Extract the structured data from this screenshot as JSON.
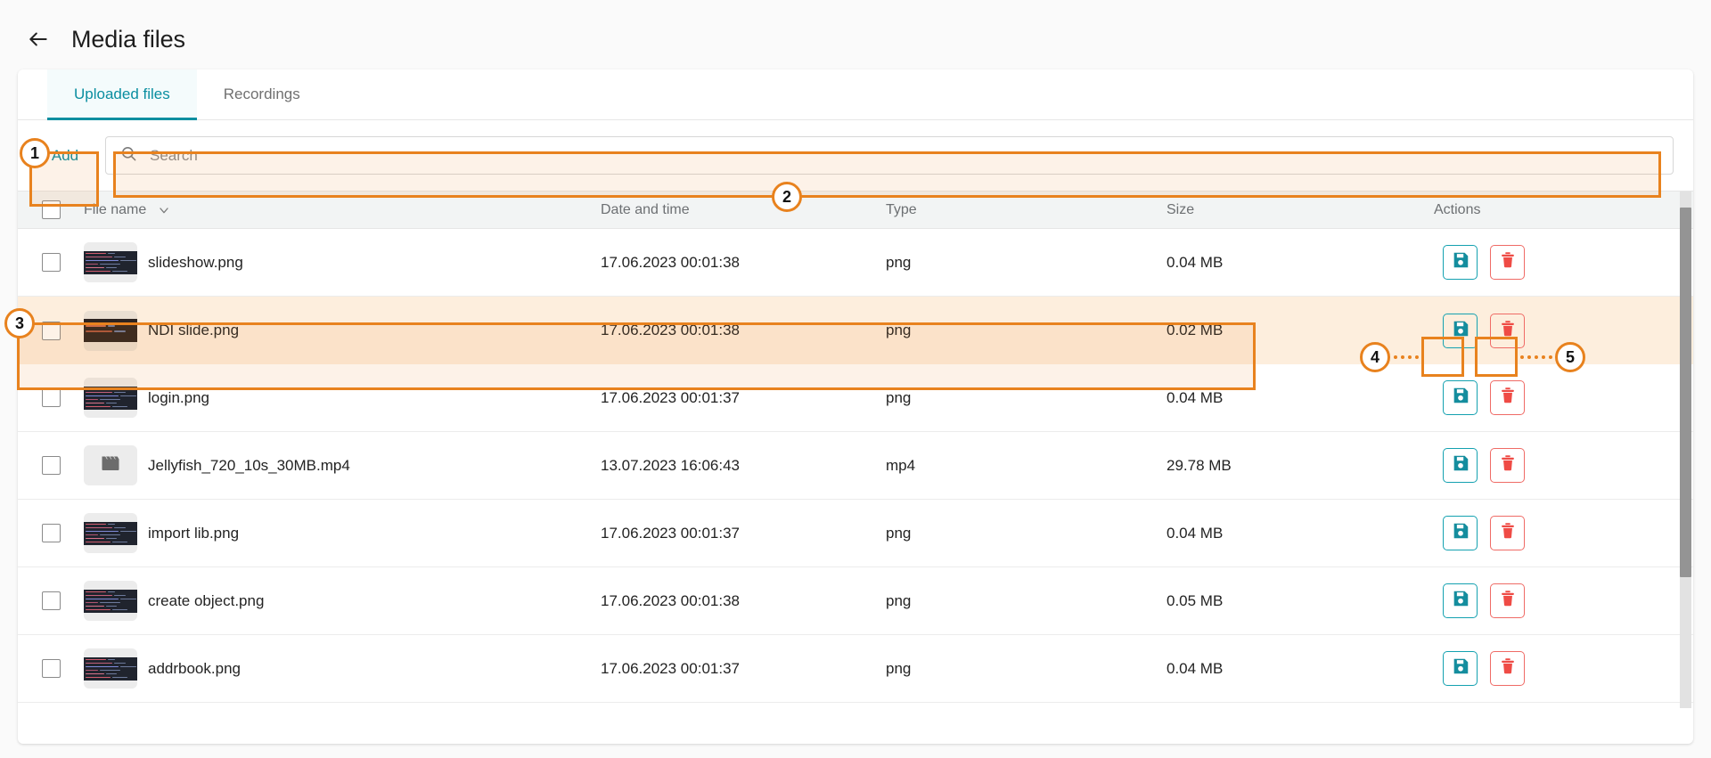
{
  "header": {
    "back_icon": "arrow-left-icon",
    "title": "Media files"
  },
  "tabs": [
    {
      "label": "Uploaded files",
      "active": true
    },
    {
      "label": "Recordings",
      "active": false
    }
  ],
  "toolbar": {
    "add_label": "Add",
    "search_placeholder": "Search",
    "search_value": "",
    "search_icon": "search-icon"
  },
  "table": {
    "columns": [
      {
        "key": "name",
        "label": "File name"
      },
      {
        "key": "date",
        "label": "Date and time"
      },
      {
        "key": "type",
        "label": "Type"
      },
      {
        "key": "size",
        "label": "Size"
      },
      {
        "key": "actions",
        "label": "Actions"
      }
    ],
    "sort_icon": "chevron-down-icon",
    "row_actions": {
      "save_icon": "save-floppy-icon",
      "delete_icon": "trash-icon"
    },
    "rows": [
      {
        "name": "slideshow.png",
        "date": "17.06.2023 00:01:38",
        "type": "png",
        "size": "0.04 MB",
        "thumb": "code",
        "highlight": false
      },
      {
        "name": "NDI slide.png",
        "date": "17.06.2023 00:01:38",
        "type": "png",
        "size": "0.02 MB",
        "thumb": "code-warm",
        "highlight": true
      },
      {
        "name": "login.png",
        "date": "17.06.2023 00:01:37",
        "type": "png",
        "size": "0.04 MB",
        "thumb": "code",
        "highlight": false
      },
      {
        "name": "Jellyfish_720_10s_30MB.mp4",
        "date": "13.07.2023 16:06:43",
        "type": "mp4",
        "size": "29.78 MB",
        "thumb": "video",
        "highlight": false
      },
      {
        "name": "import lib.png",
        "date": "17.06.2023 00:01:37",
        "type": "png",
        "size": "0.04 MB",
        "thumb": "code",
        "highlight": false
      },
      {
        "name": "create object.png",
        "date": "17.06.2023 00:01:38",
        "type": "png",
        "size": "0.05 MB",
        "thumb": "code",
        "highlight": false
      },
      {
        "name": "addrbook.png",
        "date": "17.06.2023 00:01:37",
        "type": "png",
        "size": "0.04 MB",
        "thumb": "code",
        "highlight": false
      }
    ]
  },
  "annotations": [
    {
      "number": "1",
      "target": "add-button"
    },
    {
      "number": "2",
      "target": "search-input"
    },
    {
      "number": "3",
      "target": "file-row-highlighted"
    },
    {
      "number": "4",
      "target": "row-save-button"
    },
    {
      "number": "5",
      "target": "row-delete-button"
    }
  ],
  "colors": {
    "accent_teal": "#0a8ea0",
    "annotation_orange": "#e8821e",
    "highlight_bg": "#fdeedd",
    "delete_red": "#ef4b45",
    "save_teal": "#14a1b0"
  }
}
